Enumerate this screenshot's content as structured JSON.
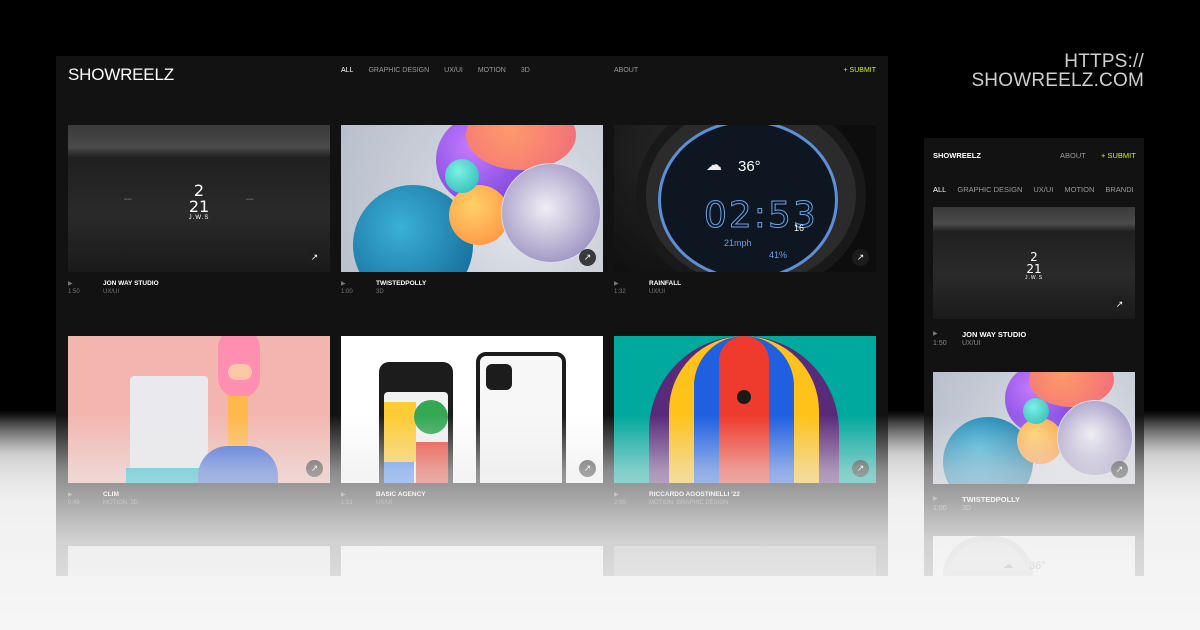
{
  "promo": {
    "url_line1": "HTTPS://",
    "url_line2": "SHOWREELZ.COM"
  },
  "desktop": {
    "logo": "SHOWREELZ",
    "nav": [
      "ALL",
      "GRAPHIC DESIGN",
      "UX/UI",
      "MOTION",
      "3D"
    ],
    "about": "ABOUT",
    "submit": "+ SUBMIT",
    "cards": [
      {
        "title": "JON WAY STUDIO",
        "category": "UX/UI",
        "duration": "1:50"
      },
      {
        "title": "TWISTEDPOLLY",
        "category": "3D",
        "duration": "1:00"
      },
      {
        "title": "RAINFALL",
        "category": "UX/UI",
        "duration": "1:32"
      },
      {
        "title": "CLIM",
        "category": "MOTION, 3D",
        "duration": "0:49"
      },
      {
        "title": "BASIC AGENCY",
        "category": "UX/UI",
        "duration": "1:21"
      },
      {
        "title": "RICCARDO AGOSTINELLI '22",
        "category": "MOTION, GRAPHIC DESIGN",
        "duration": "2:00"
      }
    ],
    "jw_logo_top": "2",
    "jw_logo_bottom": "21",
    "jw_logo_sub": "J.W.S",
    "watch": {
      "temp": "36°",
      "time": "02:53",
      "date": "16",
      "wind": "21mph",
      "humidity": "41%"
    }
  },
  "mobile": {
    "logo": "SHOWREELZ",
    "about": "ABOUT",
    "submit": "+ SUBMIT",
    "nav": [
      "ALL",
      "GRAPHIC DESIGN",
      "UX/UI",
      "MOTION",
      "BRANDI"
    ],
    "cards": [
      {
        "title": "JON WAY STUDIO",
        "category": "UX/UI",
        "duration": "1:50"
      },
      {
        "title": "TWISTEDPOLLY",
        "category": "3D",
        "duration": "1:00"
      }
    ],
    "watch_temp": "36°"
  },
  "icons": {
    "play": "▶",
    "arrow": "↗"
  },
  "colors": {
    "accent": "#c6f432",
    "background": "#121212"
  }
}
